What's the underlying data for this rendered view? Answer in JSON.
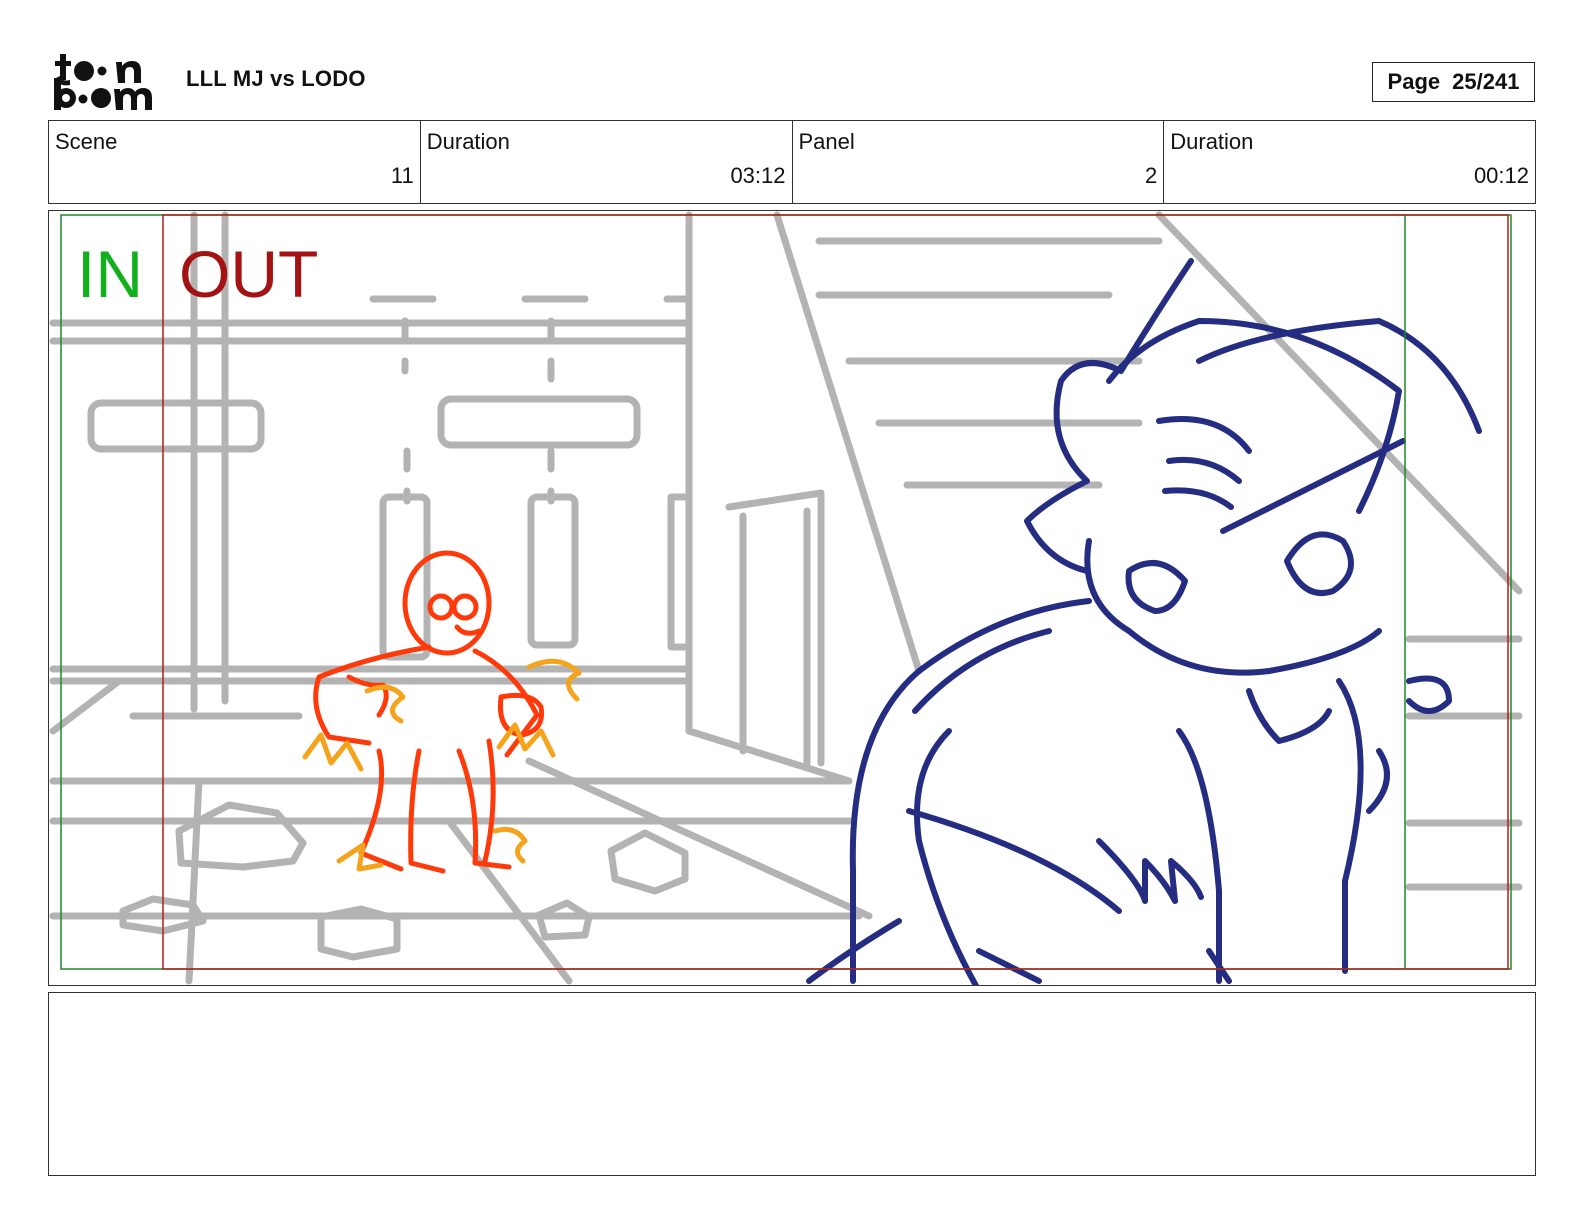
{
  "header": {
    "logo_text": "toon boom",
    "project_title": "LLL MJ vs LODO",
    "page_label": "Page",
    "page_value": "25/241"
  },
  "info_bar": {
    "scene": {
      "label": "Scene",
      "value": "11"
    },
    "scene_duration": {
      "label": "Duration",
      "value": "03:12"
    },
    "panel": {
      "label": "Panel",
      "value": "2"
    },
    "panel_duration": {
      "label": "Duration",
      "value": "00:12"
    }
  },
  "panel_image": {
    "in_marker": "IN",
    "out_marker": "OUT",
    "colors": {
      "in_marker": "#12b01d",
      "out_marker": "#a41313",
      "background_sketch": "#b3b3b3",
      "small_character": "#ff3a0a",
      "effect_lines": "#f5a31a",
      "large_character": "#252d82"
    }
  },
  "notes": {
    "text": ""
  }
}
